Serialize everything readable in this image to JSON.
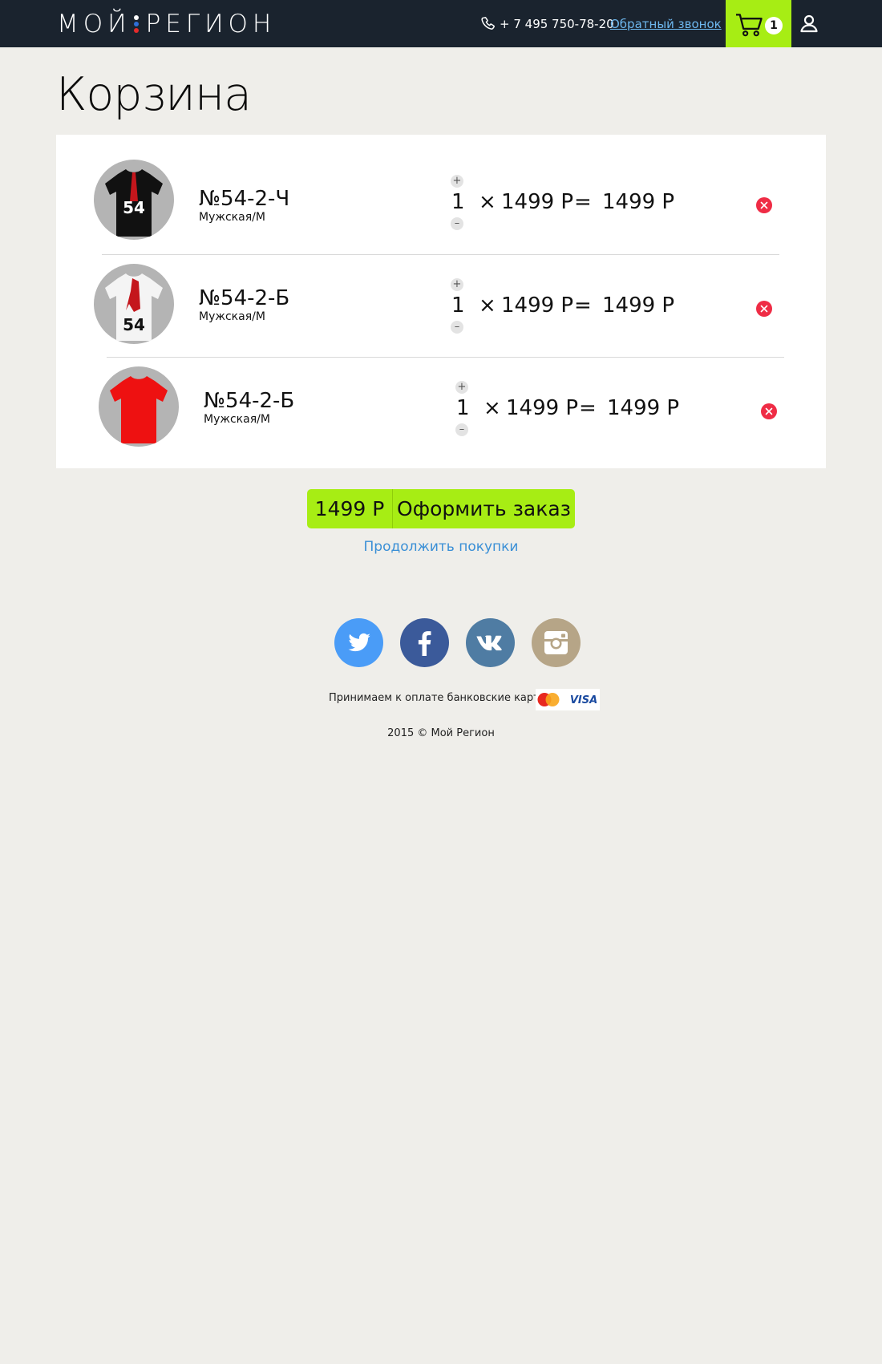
{
  "header": {
    "logo_left": "МОЙ",
    "logo_right": "РЕГИОН",
    "phone": "+ 7 495 750-78-20",
    "callback_label": "Обратный звонок",
    "cart_count": "1"
  },
  "page": {
    "title": "Корзина"
  },
  "cart": {
    "items": [
      {
        "name": "№54-2-Ч",
        "variant": "Мужская/М",
        "qty": "1",
        "times": "×",
        "price": "1499 Р",
        "equals": "=",
        "total": "1499 Р",
        "shirt_color": "#111111"
      },
      {
        "name": "№54-2-Б",
        "variant": "Мужская/М",
        "qty": "1",
        "times": "×",
        "price": "1499 Р",
        "equals": "=",
        "total": "1499 Р",
        "shirt_color": "#f4f4f4"
      },
      {
        "name": "№54-2-Б",
        "variant": "Мужская/М",
        "qty": "1",
        "times": "×",
        "price": "1499 Р",
        "equals": "=",
        "total": "1499 Р",
        "shirt_color": "#ee1111"
      }
    ],
    "qty_plus": "+",
    "qty_minus": "–"
  },
  "checkout": {
    "total": "1499 Р",
    "label": "Оформить заказ"
  },
  "continue_label": "Продолжить покупки",
  "footer": {
    "socials": [
      {
        "name": "twitter-icon",
        "color": "#4a9cf7"
      },
      {
        "name": "facebook-icon",
        "color": "#3b5a9a"
      },
      {
        "name": "vk-icon",
        "color": "#4f7ca3"
      },
      {
        "name": "instagram-icon",
        "color": "#b6a587"
      }
    ],
    "payments_text": "Принимаем к оплате банковские карты:",
    "visa_text": "VISA",
    "copyright": "2015 © Мой Регион"
  },
  "colors": {
    "accent": "#a7ed14",
    "header_bg": "#1a232e",
    "remove": "#ef2c45",
    "link": "#3a8fd6"
  }
}
